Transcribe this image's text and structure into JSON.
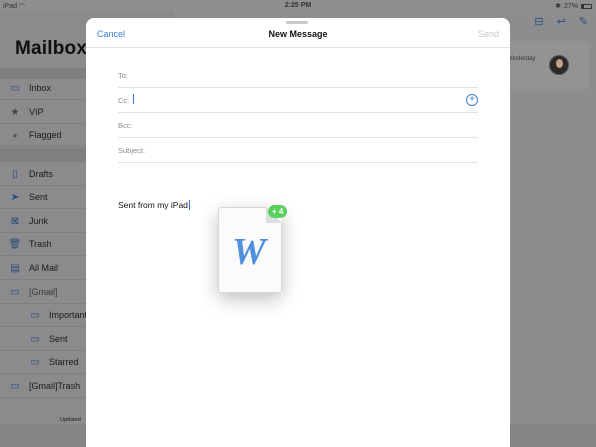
{
  "status_bar": {
    "device": "iPad",
    "wifi_icon": "wifi-icon",
    "time": "2:25 PM",
    "bluetooth_icon": "bluetooth-icon",
    "battery_percent": "27%",
    "battery_level": 0.27
  },
  "sidebar": {
    "title": "Mailboxe",
    "items": [
      {
        "label": "Inbox",
        "icon": "inbox-icon"
      },
      {
        "label": "VIP",
        "icon": "star-icon"
      },
      {
        "label": "Flagged",
        "icon": "flag-dot-icon"
      },
      {
        "label": "Drafts",
        "icon": "document-icon"
      },
      {
        "label": "Sent",
        "icon": "paper-plane-icon"
      },
      {
        "label": "Junk",
        "icon": "junk-icon"
      },
      {
        "label": "Trash",
        "icon": "trash-icon"
      },
      {
        "label": "All Mail",
        "icon": "archive-icon"
      },
      {
        "label": "[Gmail]",
        "icon": "folder-icon"
      },
      {
        "label": "Important",
        "icon": "folder-icon"
      },
      {
        "label": "Sent",
        "icon": "folder-icon"
      },
      {
        "label": "Starred",
        "icon": "folder-icon"
      },
      {
        "label": "[Gmail]Trash",
        "icon": "folder-icon"
      }
    ],
    "updated_text": "Updated"
  },
  "message_list": {
    "date": "Yesterday",
    "toolbar_icons": [
      "archive-icon",
      "reply-icon",
      "compose-icon"
    ]
  },
  "compose": {
    "cancel_label": "Cancel",
    "title": "New Message",
    "send_label": "Send",
    "to_label": "To:",
    "cc_label": "Cc:",
    "bcc_label": "Bcc:",
    "subject_label": "Subject:",
    "add_recipient_icon": "plus-circle-icon",
    "body_text": "Sent from my iPad"
  },
  "drag": {
    "document_icon": "word-document-icon",
    "letter": "W",
    "badge": "+ 4"
  },
  "colors": {
    "accent": "#3a7bd5",
    "badge": "#5cd05c",
    "word_blue": "#4f8fe0"
  }
}
